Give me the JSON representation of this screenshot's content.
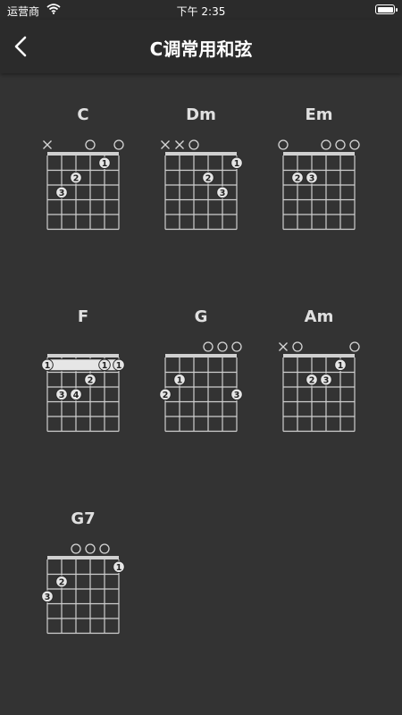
{
  "status_bar": {
    "carrier": "运营商",
    "time": "下午 2:35"
  },
  "header": {
    "title": "C调常用和弦"
  },
  "chords": [
    {
      "name": "C",
      "markers": [
        "x",
        "",
        "",
        "o",
        "",
        "o"
      ],
      "barre": null,
      "dots": [
        {
          "string": 5,
          "fret": 1,
          "finger": "1"
        },
        {
          "string": 3,
          "fret": 2,
          "finger": "2"
        },
        {
          "string": 2,
          "fret": 3,
          "finger": "3"
        }
      ]
    },
    {
      "name": "Dm",
      "markers": [
        "x",
        "x",
        "o",
        "",
        "",
        ""
      ],
      "barre": null,
      "dots": [
        {
          "string": 6,
          "fret": 1,
          "finger": "1"
        },
        {
          "string": 4,
          "fret": 2,
          "finger": "2"
        },
        {
          "string": 5,
          "fret": 3,
          "finger": "3"
        }
      ]
    },
    {
      "name": "Em",
      "markers": [
        "o",
        "",
        "",
        "o",
        "o",
        "o"
      ],
      "barre": null,
      "dots": [
        {
          "string": 2,
          "fret": 2,
          "finger": "2"
        },
        {
          "string": 3,
          "fret": 2,
          "finger": "3"
        }
      ]
    },
    {
      "name": "F",
      "markers": [
        "",
        "",
        "",
        "",
        "",
        ""
      ],
      "barre": {
        "fret": 1,
        "from": 1,
        "to": 6,
        "labels": [
          "1",
          "1",
          "1"
        ]
      },
      "dots": [
        {
          "string": 4,
          "fret": 2,
          "finger": "2"
        },
        {
          "string": 2,
          "fret": 3,
          "finger": "3"
        },
        {
          "string": 3,
          "fret": 3,
          "finger": "4"
        }
      ]
    },
    {
      "name": "G",
      "markers": [
        "",
        "",
        "",
        "o",
        "o",
        "o"
      ],
      "barre": null,
      "dots": [
        {
          "string": 2,
          "fret": 2,
          "finger": "1"
        },
        {
          "string": 1,
          "fret": 3,
          "finger": "2"
        },
        {
          "string": 6,
          "fret": 3,
          "finger": "3"
        }
      ]
    },
    {
      "name": "Am",
      "markers": [
        "x",
        "o",
        "",
        "",
        "",
        "o"
      ],
      "barre": null,
      "dots": [
        {
          "string": 5,
          "fret": 1,
          "finger": "1"
        },
        {
          "string": 3,
          "fret": 2,
          "finger": "2"
        },
        {
          "string": 4,
          "fret": 2,
          "finger": "3"
        }
      ]
    },
    {
      "name": "G7",
      "markers": [
        "",
        "",
        "o",
        "o",
        "o",
        ""
      ],
      "barre": null,
      "dots": [
        {
          "string": 6,
          "fret": 1,
          "finger": "1"
        },
        {
          "string": 2,
          "fret": 2,
          "finger": "2"
        },
        {
          "string": 1,
          "fret": 3,
          "finger": "3"
        }
      ]
    }
  ]
}
